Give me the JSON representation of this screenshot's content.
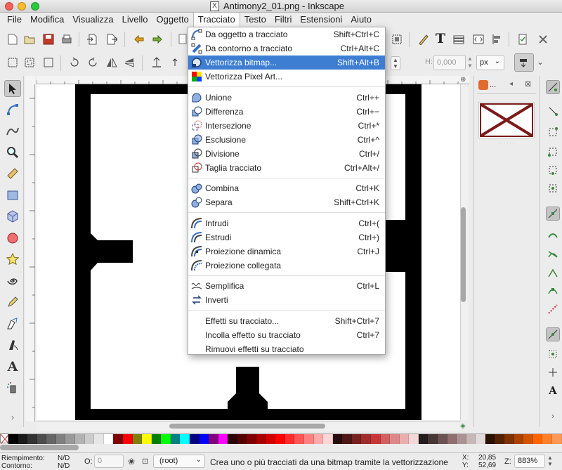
{
  "window": {
    "title": "Antimony2_01.png - Inkscape"
  },
  "menubar": [
    "File",
    "Modifica",
    "Visualizza",
    "Livello",
    "Oggetto",
    "Tracciato",
    "Testo",
    "Filtri",
    "Estensioni",
    "Aiuto"
  ],
  "menubar_active": "Tracciato",
  "dropdown": {
    "groups": [
      [
        {
          "label": "Da oggetto a tracciato",
          "accel": "Shift+Ctrl+C",
          "icon": "object-to-path-icon"
        },
        {
          "label": "Da contorno a tracciato",
          "accel": "Ctrl+Alt+C",
          "icon": "stroke-to-path-icon"
        },
        {
          "label": "Vettorizza bitmap...",
          "accel": "Shift+Alt+B",
          "icon": "trace-bitmap-icon",
          "highlighted": true
        },
        {
          "label": "Vettorizza Pixel Art...",
          "accel": "",
          "icon": "pixel-art-icon"
        }
      ],
      [
        {
          "label": "Unione",
          "accel": "Ctrl++",
          "icon": "union-icon"
        },
        {
          "label": "Differenza",
          "accel": "Ctrl+−",
          "icon": "difference-icon"
        },
        {
          "label": "Intersezione",
          "accel": "Ctrl+*",
          "icon": "intersection-icon"
        },
        {
          "label": "Esclusione",
          "accel": "Ctrl+^",
          "icon": "exclusion-icon"
        },
        {
          "label": "Divisione",
          "accel": "Ctrl+/",
          "icon": "division-icon"
        },
        {
          "label": "Taglia tracciato",
          "accel": "Ctrl+Alt+/",
          "icon": "cut-path-icon"
        }
      ],
      [
        {
          "label": "Combina",
          "accel": "Ctrl+K",
          "icon": "combine-icon"
        },
        {
          "label": "Separa",
          "accel": "Shift+Ctrl+K",
          "icon": "break-apart-icon"
        }
      ],
      [
        {
          "label": "Intrudi",
          "accel": "Ctrl+(",
          "icon": "inset-icon"
        },
        {
          "label": "Estrudi",
          "accel": "Ctrl+)",
          "icon": "outset-icon"
        },
        {
          "label": "Proiezione dinamica",
          "accel": "Ctrl+J",
          "icon": "dynamic-offset-icon"
        },
        {
          "label": "Proiezione collegata",
          "accel": "",
          "icon": "linked-offset-icon"
        }
      ],
      [
        {
          "label": "Semplifica",
          "accel": "Ctrl+L",
          "icon": "simplify-icon"
        },
        {
          "label": "Inverti",
          "accel": "",
          "icon": "reverse-icon"
        }
      ],
      [
        {
          "label": "Effetti su tracciato...",
          "accel": "Shift+Ctrl+7",
          "icon": ""
        },
        {
          "label": "Incolla effetto su tracciato",
          "accel": "Ctrl+7",
          "icon": ""
        },
        {
          "label": "Rimuovi effetti su tracciato",
          "accel": "",
          "icon": ""
        }
      ]
    ]
  },
  "toolbar": {
    "h_label": "H:",
    "h_value": "0,000",
    "unit": "px"
  },
  "swatches_panel": {
    "label": "..."
  },
  "palette_colors": [
    "#000000",
    "#1a1a1a",
    "#333333",
    "#4d4d4d",
    "#666666",
    "#808080",
    "#999999",
    "#b3b3b3",
    "#cccccc",
    "#e6e6e6",
    "#ffffff",
    "#800000",
    "#ff0000",
    "#808000",
    "#ffff00",
    "#008000",
    "#00ff00",
    "#008080",
    "#00ffff",
    "#000080",
    "#0000ff",
    "#800080",
    "#ff00ff",
    "#2b0000",
    "#550000",
    "#800000",
    "#aa0000",
    "#d40000",
    "#ff0000",
    "#ff2a2a",
    "#ff5555",
    "#ff8080",
    "#ffaaaa",
    "#ffd5d5",
    "#280b0b",
    "#501616",
    "#782121",
    "#a02c2c",
    "#c83737",
    "#d35f5f",
    "#de8787",
    "#e9afaf",
    "#f4d7d7",
    "#241c1c",
    "#483737",
    "#6c5353",
    "#916f6f",
    "#ac9393",
    "#c8b7b7",
    "#e3dbdb",
    "#2b1100",
    "#552200",
    "#803300",
    "#aa4400",
    "#d45500",
    "#ff6600",
    "#ff7f2a",
    "#ff9955"
  ],
  "statusbar": {
    "fill_label": "Riempimento:",
    "fill_value": "N/D",
    "stroke_label": "Contorno:",
    "stroke_value": "N/D",
    "opacity_label": "O:",
    "opacity_value": "0",
    "layer": "(root)",
    "message": "Crea uno o più tracciati da una bitmap tramite la vettorizzazione",
    "x_label": "X:",
    "x_value": "20,85",
    "y_label": "Y:",
    "y_value": "52,69",
    "zoom_label": "Z:",
    "zoom_value": "883%"
  }
}
